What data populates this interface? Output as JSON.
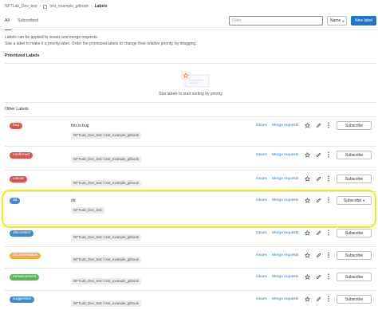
{
  "breadcrumb": {
    "items": [
      "NFTLab_Dev_test",
      "test_example_gitbook",
      "Labels"
    ]
  },
  "tabs": {
    "all": "All",
    "subscribed": "Subscribed"
  },
  "toolbar": {
    "filter_placeholder": "Filter",
    "sort_label": "Name",
    "new_label": "New label"
  },
  "description": {
    "line1": "Labels can be applied to issues and merge requests.",
    "line2": "Star a label to make it a priority label. Order the prioritized labels to change their relative priority, by dragging."
  },
  "prioritized": {
    "title": "Prioritized Labels",
    "empty_text": "Star labels to start sorting by priority"
  },
  "other": {
    "title": "Other Labels"
  },
  "labels": [
    {
      "name": "bug",
      "color": "#d9534f",
      "description": "this is bug",
      "path": "NFTLab_Dev_test / test_example_gitbook",
      "issues": "Issues",
      "sep": "·",
      "mrs": "Merge requests",
      "subscribe": "Subscribe"
    },
    {
      "name": "confirmed",
      "color": "#d9534f",
      "description": "",
      "path": "NFTLab_Dev_test / test_example_gitbook",
      "issues": "Issues",
      "sep": "·",
      "mrs": "Merge requests",
      "subscribe": "Subscribe"
    },
    {
      "name": "critical",
      "color": "#d9534f",
      "description": "",
      "path": "NFTLab_Dev_test / test_example_gitbook",
      "issues": "Issues",
      "sep": "·",
      "mrs": "Merge requests",
      "subscribe": "Subscribe"
    },
    {
      "name": "dd",
      "color": "#428bca",
      "description": "dd",
      "path": "NFTLab_Dev_test",
      "issues": "Issues",
      "sep": "·",
      "mrs": "Merge requests",
      "subscribe": "Subscribe"
    },
    {
      "name": "discussion",
      "color": "#428bca",
      "description": "",
      "path": "NFTLab_Dev_test / test_example_gitbook",
      "issues": "Issues",
      "sep": "·",
      "mrs": "Merge requests",
      "subscribe": "Subscribe"
    },
    {
      "name": "documentation",
      "color": "#f0ad4e",
      "description": "",
      "path": "NFTLab_Dev_test / test_example_gitbook",
      "issues": "Issues",
      "sep": "·",
      "mrs": "Merge requests",
      "subscribe": "Subscribe"
    },
    {
      "name": "enhancement",
      "color": "#5cb85c",
      "description": "",
      "path": "NFTLab_Dev_test / test_example_gitbook",
      "issues": "Issues",
      "sep": "·",
      "mrs": "Merge requests",
      "subscribe": "Subscribe"
    },
    {
      "name": "suggestion",
      "color": "#428bca",
      "description": "",
      "path": "NFTLab_Dev_test / test_example_gitbook",
      "issues": "Issues",
      "sep": "·",
      "mrs": "Merge requests",
      "subscribe": "Subscribe"
    }
  ],
  "colors": {
    "accent": "#1f75cb",
    "highlight": "#f3ec14"
  }
}
